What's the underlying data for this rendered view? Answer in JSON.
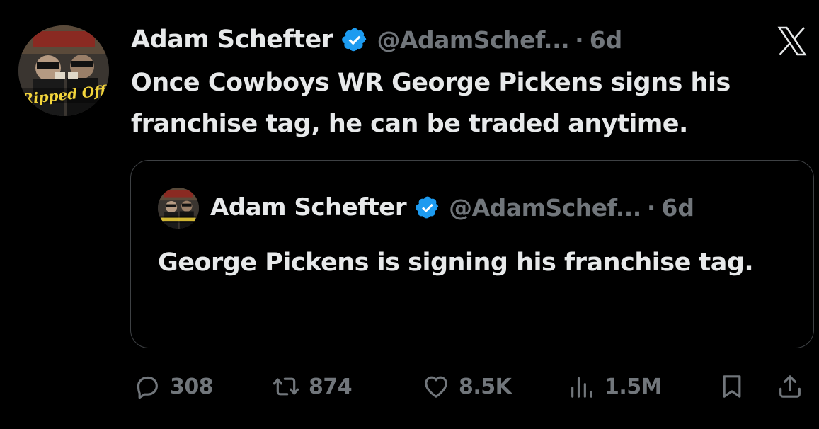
{
  "tweet": {
    "author_name": "Adam Schefter",
    "handle": "@AdamSchef...",
    "separator": "·",
    "time": "6d",
    "text": "Once Cowboys WR George Pickens signs his franchise tag, he can be traded anytime.",
    "avatar_caption": "Ripped Off"
  },
  "quoted_tweet": {
    "author_name": "Adam Schefter",
    "handle": "@AdamSchef...",
    "separator": "·",
    "time": "6d",
    "text": "George Pickens is signing his franchise tag."
  },
  "actions": {
    "replies": "308",
    "reposts": "874",
    "likes": "8.5K",
    "views": "1.5M"
  },
  "icons": {
    "verified": "verified-badge-icon",
    "platform": "x-logo-icon",
    "reply": "reply-icon",
    "repost": "repost-icon",
    "like": "heart-icon",
    "views": "views-chart-icon",
    "bookmark": "bookmark-icon",
    "share": "share-icon"
  },
  "colors": {
    "background": "#000000",
    "text_primary": "#e7e9ea",
    "text_secondary": "#71767b",
    "verified_blue": "#1d9bf0",
    "border": "#3e4144"
  }
}
